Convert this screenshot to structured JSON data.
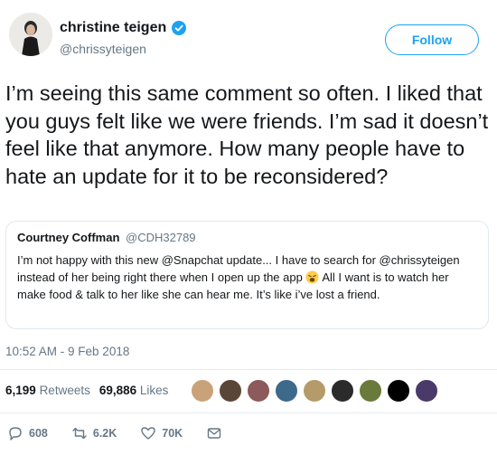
{
  "author": {
    "name": "christine teigen",
    "handle": "@chrissyteigen"
  },
  "follow_label": "Follow",
  "tweet_text": "I’m seeing this same comment so often. I liked that you guys felt like we were friends. I’m sad it doesn’t feel like that anymore. How many people have to hate an update for it to be reconsidered?",
  "quote": {
    "name": "Courtney Coffman",
    "handle": "@CDH32789",
    "text_before_emoji": "I’m not happy with this new @Snapchat update... I have to search for @chrissyteigen instead of her being right there when I open up the app ",
    "text_after_emoji": " All I want is to watch her make food & talk to her like she can hear me. It’s like i’ve lost a friend."
  },
  "timestamp": "10:52 AM - 9 Feb 2018",
  "stats": {
    "retweets_count": "6,199",
    "retweets_label": "Retweets",
    "likes_count": "69,886",
    "likes_label": "Likes"
  },
  "liker_colors": [
    "#c9a27a",
    "#5a4638",
    "#8c5a5a",
    "#3d6a8a",
    "#b59a6a",
    "#2b2b2b",
    "#6a7a3a",
    "#000000",
    "#4a3a6a"
  ],
  "actions": {
    "reply_count": "608",
    "retweet_count": "6.2K",
    "like_count": "70K"
  },
  "colors": {
    "accent": "#1da1f2",
    "secondary_text": "#657786"
  }
}
